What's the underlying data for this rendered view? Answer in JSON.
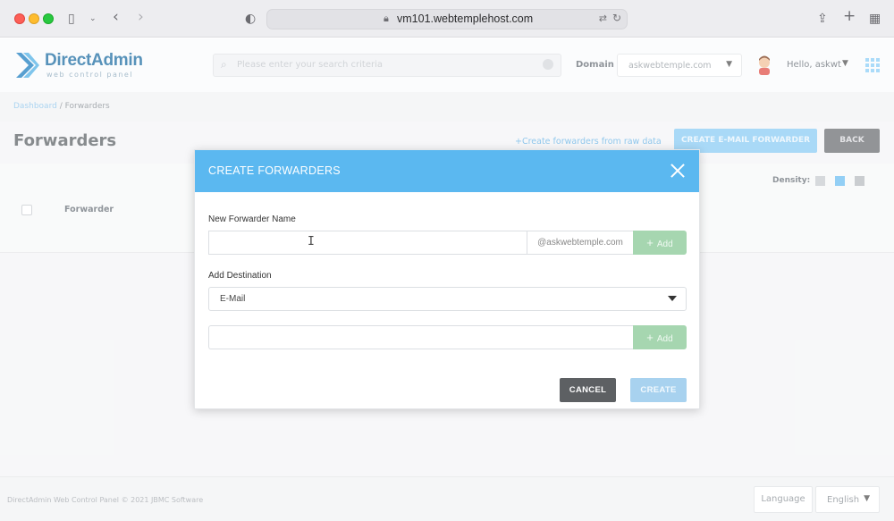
{
  "browser": {
    "url": "vm101.webtemplehost.com"
  },
  "header": {
    "logo_name": "DirectAdmin",
    "logo_sub": "web control panel",
    "search_placeholder": "Please enter your search criteria",
    "domain_label": "Domain",
    "domain_value": "askwebtemple.com",
    "greeting": "Hello, askwt"
  },
  "breadcrumb": {
    "root": "Dashboard",
    "separator": "/",
    "current": "Forwarders"
  },
  "page": {
    "title": "Forwarders",
    "raw_link": "+Create forwarders from raw data",
    "create_email_forwarder": "CREATE E-MAIL FORWARDER",
    "back": "BACK",
    "density_label": "Density:",
    "table_header_forwarder": "Forwarder"
  },
  "footer": {
    "copyright": "DirectAdmin Web Control Panel © 2021 JBMC Software",
    "language_button": "Language",
    "language_value": "English"
  },
  "modal": {
    "title": "CREATE FORWARDERS",
    "name_label": "New Forwarder Name",
    "name_value": "",
    "domain_suffix": "@askwebtemple.com",
    "add_label": "Add",
    "destination_label": "Add Destination",
    "destination_type": "E-Mail",
    "destination_value": "",
    "cancel": "CANCEL",
    "create": "CREATE"
  },
  "colors": {
    "modal_header": "#5bb8f0",
    "add_button": "#a6d6b0",
    "cancel_button": "#5d6063",
    "create_button": "#a8d2ef"
  }
}
